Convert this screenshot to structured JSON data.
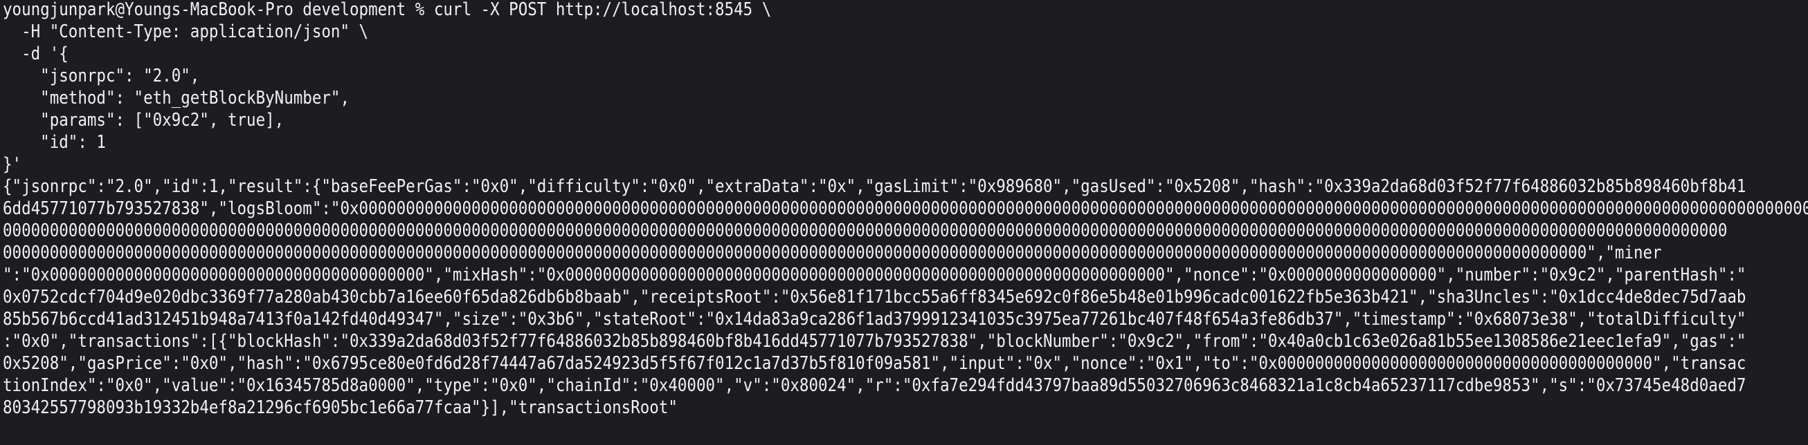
{
  "terminal": {
    "lines": [
      "youngjunpark@Youngs-MacBook-Pro development % curl -X POST http://localhost:8545 \\",
      "  -H \"Content-Type: application/json\" \\",
      "  -d '{",
      "    \"jsonrpc\": \"2.0\",",
      "    \"method\": \"eth_getBlockByNumber\",",
      "    \"params\": [\"0x9c2\", true],",
      "    \"id\": 1",
      "}'",
      "{\"jsonrpc\":\"2.0\",\"id\":1,\"result\":{\"baseFeePerGas\":\"0x0\",\"difficulty\":\"0x0\",\"extraData\":\"0x\",\"gasLimit\":\"0x989680\",\"gasUsed\":\"0x5208\",\"hash\":\"0x339a2da68d03f52f77f64886032b85b898460bf8b41",
      "6dd45771077b793527838\",\"logsBloom\":\"0x000000000000000000000000000000000000000000000000000000000000000000000000000000000000000000000000000000000000000000000000000000000000000000000000000000000000",
      "0000000000000000000000000000000000000000000000000000000000000000000000000000000000000000000000000000000000000000000000000000000000000000000000000000000000000000000000000000000000000000",
      "0000000000000000000000000000000000000000000000000000000000000000000000000000000000000000000000000000000000000000000000000000000000000000000000000000000000000000000000000\",\"miner",
      "\":\"0x0000000000000000000000000000000000000000\",\"mixHash\":\"0x0000000000000000000000000000000000000000000000000000000000000000\",\"nonce\":\"0x0000000000000000\",\"number\":\"0x9c2\",\"parentHash\":\"",
      "0x0752cdcf704d9e020dbc3369f77a280ab430cbb7a16ee60f65da826db6b8baab\",\"receiptsRoot\":\"0x56e81f171bcc55a6ff8345e692c0f86e5b48e01b996cadc001622fb5e363b421\",\"sha3Uncles\":\"0x1dcc4de8dec75d7aab",
      "85b567b6ccd41ad312451b948a7413f0a142fd40d49347\",\"size\":\"0x3b6\",\"stateRoot\":\"0x14da83a9ca286f1ad3799912341035c3975ea77261bc407f48f654a3fe86db37\",\"timestamp\":\"0x68073e38\",\"totalDifficulty\"",
      ":\"0x0\",\"transactions\":[{\"blockHash\":\"0x339a2da68d03f52f77f64886032b85b898460bf8b416dd45771077b793527838\",\"blockNumber\":\"0x9c2\",\"from\":\"0x40a0cb1c63e026a81b55ee1308586e21eec1efa9\",\"gas\":\"",
      "0x5208\",\"gasPrice\":\"0x0\",\"hash\":\"0x6795ce80e0fd6d28f74447a67da524923d5f5f67f012c1a7d37b5f810f09a581\",\"input\":\"0x\",\"nonce\":\"0x1\",\"to\":\"0x0000000000000000000000000000000000000000\",\"transac",
      "tionIndex\":\"0x0\",\"value\":\"0x16345785d8a0000\",\"type\":\"0x0\",\"chainId\":\"0x40000\",\"v\":\"0x80024\",\"r\":\"0xfa7e294fdd43797baa89d55032706963c8468321a1c8cb4a65237117cdbe9853\",\"s\":\"0x73745e48d0aed7",
      "80342557798093b19332b4ef8a21296cf6905bc1e66a77fcaa\"}],\"transactionsRoot\""
    ]
  }
}
